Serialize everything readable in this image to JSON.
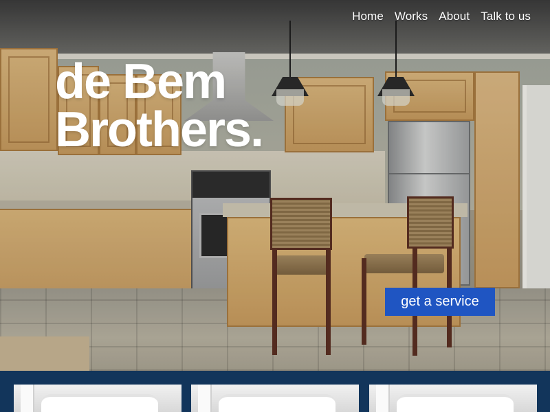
{
  "nav": {
    "items": [
      {
        "label": "Home"
      },
      {
        "label": "Works"
      },
      {
        "label": "About"
      },
      {
        "label": "Talk to us"
      }
    ]
  },
  "hero": {
    "title_line1": "de Bem",
    "title_line2": "Brothers.",
    "cta_label": "get a service"
  },
  "colors": {
    "cta_background": "#1f55c2",
    "services_background": "#12355b",
    "title_text": "#ffffff"
  },
  "services": {
    "cards": [
      {
        "image": "crown-molding-photo"
      },
      {
        "image": "crown-molding-photo"
      },
      {
        "image": "crown-molding-photo"
      }
    ]
  }
}
